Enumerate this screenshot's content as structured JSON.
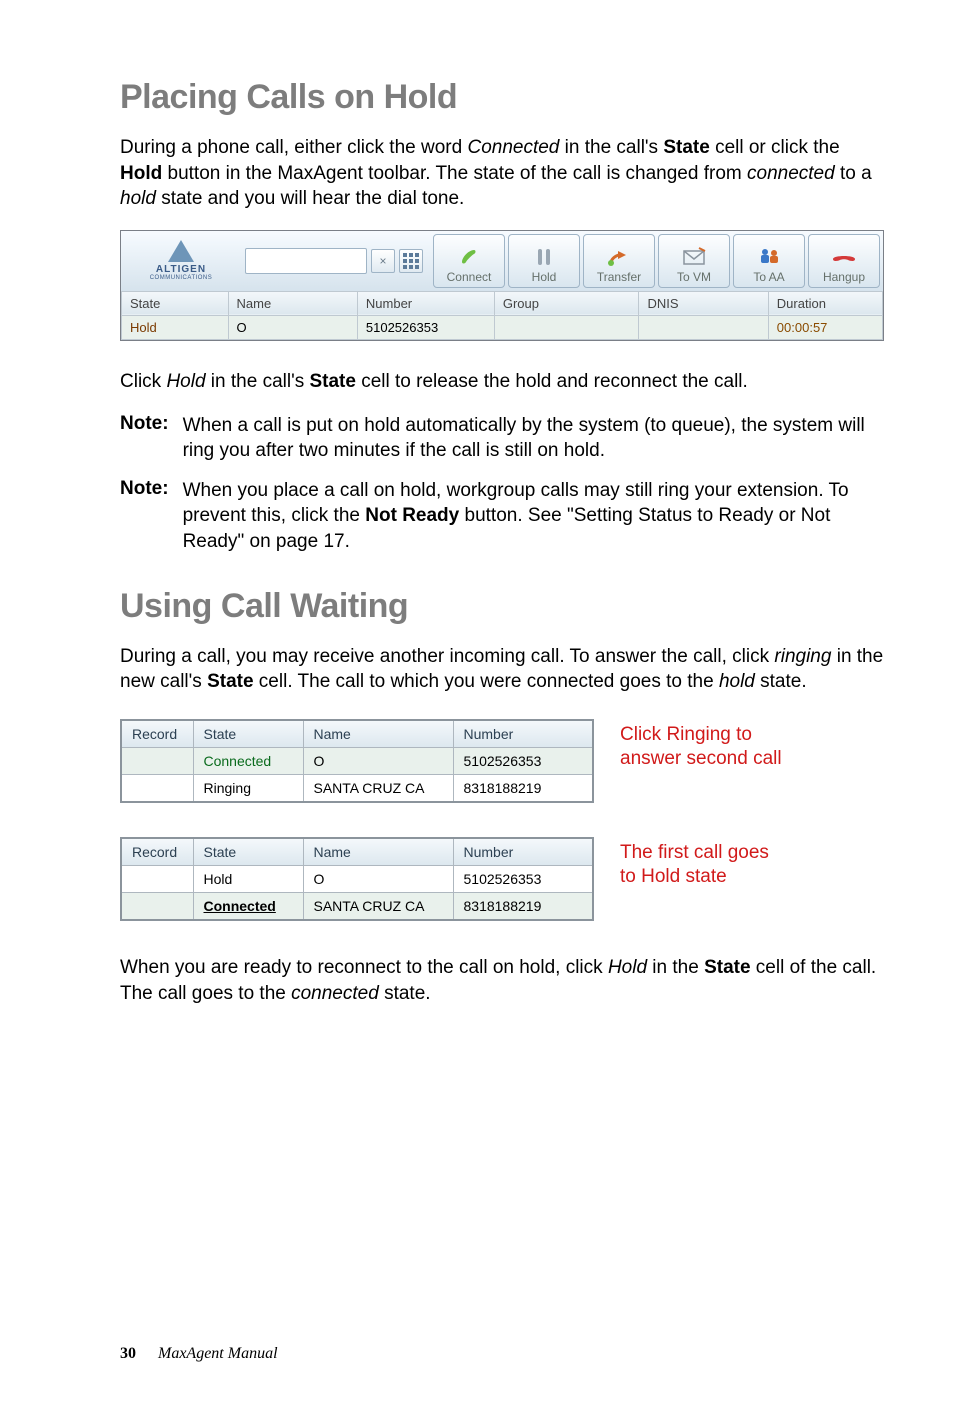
{
  "h1a": "Placing Calls on Hold",
  "p1_a": "During a phone call, either click the word ",
  "p1_b": "Connected",
  "p1_c": " in the call's ",
  "p1_d": "State",
  "p1_e": " cell or click the ",
  "p1_f": "Hold",
  "p1_g": " button in the MaxAgent toolbar. The state of the call is changed from ",
  "p1_h": "connected",
  "p1_i": " to a ",
  "p1_j": "hold",
  "p1_k": " state and you will hear the dial tone.",
  "logo_text": "ALTIGEN",
  "logo_sub": "COMMUNICATIONS",
  "tb": {
    "connect": "Connect",
    "hold": "Hold",
    "transfer": "Transfer",
    "tovm": "To VM",
    "toaa": "To AA",
    "hangup": "Hangup"
  },
  "cols": {
    "state": "State",
    "name": "Name",
    "number": "Number",
    "group": "Group",
    "dnis": "DNIS",
    "duration": "Duration"
  },
  "row": {
    "state": "Hold",
    "name": "O",
    "number": "5102526353",
    "group": "",
    "dnis": "",
    "duration": "00:00:57"
  },
  "p2_a": "Click ",
  "p2_b": "Hold",
  "p2_c": " in the call's ",
  "p2_d": "State",
  "p2_e": " cell to release the hold and reconnect the call.",
  "note_label": "Note:",
  "note1": "When a call is put on hold automatically by the system (to queue), the system will ring you after two minutes if the call is still on hold.",
  "note2_a": "When you place a call on hold, workgroup calls may still ring your extension. To prevent this, click the ",
  "note2_b": "Not Ready",
  "note2_c": " button. See \"Setting Status to Ready or Not Ready\" on page 17.",
  "h1b": "Using Call Waiting",
  "p3_a": "During a call, you may receive another incoming call. To answer the call, click ",
  "p3_b": "ringing",
  "p3_c": " in the new call's ",
  "p3_d": "State",
  "p3_e": " cell. The call to which you were connected goes to the ",
  "p3_f": "hold",
  "p3_g": " state.",
  "mini_cols": {
    "record": "Record",
    "state": "State",
    "name": "Name",
    "number": "Number"
  },
  "t1r1": {
    "state": "Connected",
    "name": "O",
    "number": "5102526353"
  },
  "t1r2": {
    "state": "Ringing",
    "name": "SANTA CRUZ  CA",
    "number": "8318188219"
  },
  "side1": "Click Ringing to answer second call",
  "t2r1": {
    "state": "Hold",
    "name": "O",
    "number": "5102526353"
  },
  "t2r2": {
    "state": "Connected",
    "name": "SANTA CRUZ  CA",
    "number": "8318188219"
  },
  "side2": "The first call goes to Hold state",
  "p4_a": "When you are ready to reconnect to the call on hold, click ",
  "p4_b": "Hold",
  "p4_c": " in the ",
  "p4_d": "State",
  "p4_e": " cell of the call. The call goes to the ",
  "p4_f": "connected",
  "p4_g": " state.",
  "page_no": "30",
  "footer_title": "MaxAgent Manual"
}
